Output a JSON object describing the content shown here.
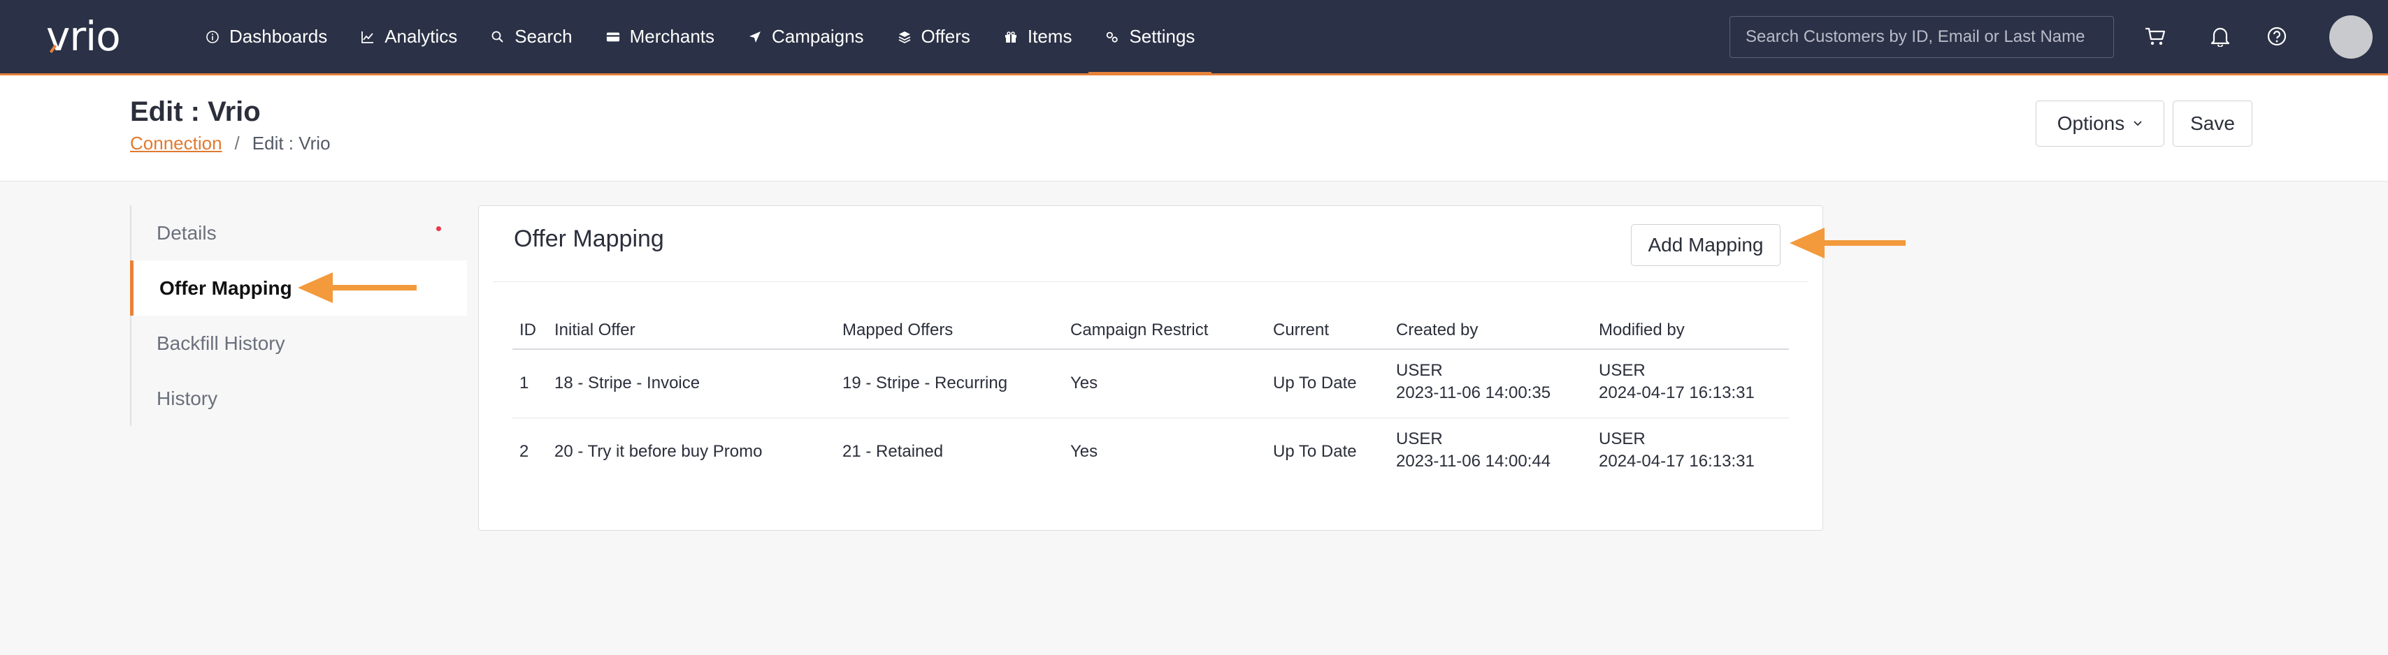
{
  "app": {
    "logo_text": "vrio"
  },
  "nav": {
    "items": [
      {
        "label": "Dashboards",
        "icon": "info-circle-icon"
      },
      {
        "label": "Analytics",
        "icon": "line-chart-icon"
      },
      {
        "label": "Search",
        "icon": "search-icon"
      },
      {
        "label": "Merchants",
        "icon": "credit-card-icon"
      },
      {
        "label": "Campaigns",
        "icon": "paper-plane-icon"
      },
      {
        "label": "Offers",
        "icon": "layers-icon"
      },
      {
        "label": "Items",
        "icon": "gift-box-icon"
      },
      {
        "label": "Settings",
        "icon": "gears-icon"
      }
    ],
    "active": "Settings",
    "search_placeholder": "Search Customers by ID, Email or Last Name",
    "icons": [
      "cart-icon",
      "bell-icon",
      "help-icon"
    ]
  },
  "header": {
    "title": "Edit : Vrio",
    "breadcrumb": {
      "link": "Connection",
      "separator": "/",
      "current": "Edit : Vrio"
    },
    "options_label": "Options",
    "save_label": "Save"
  },
  "sidebar": {
    "items": [
      {
        "label": "Details"
      },
      {
        "label": "Offer Mapping"
      },
      {
        "label": "Backfill History"
      },
      {
        "label": "History"
      }
    ],
    "active": "Offer Mapping"
  },
  "card": {
    "title": "Offer Mapping",
    "add_label": "Add Mapping",
    "columns": [
      "ID",
      "Initial Offer",
      "Mapped Offers",
      "Campaign Restrict",
      "Current",
      "Created by",
      "Modified by"
    ],
    "rows": [
      {
        "id": "1",
        "initial": "18 - Stripe - Invoice",
        "mapped": "19 - Stripe - Recurring",
        "restrict": "Yes",
        "current": "Up To Date",
        "created_user": "USER",
        "created_at": "2023-11-06 14:00:35",
        "modified_user": "USER",
        "modified_at": "2024-04-17 16:13:31"
      },
      {
        "id": "2",
        "initial": "20 - Try it before buy Promo",
        "mapped": "21 - Retained",
        "restrict": "Yes",
        "current": "Up To Date",
        "created_user": "USER",
        "created_at": "2023-11-06 14:00:44",
        "modified_user": "USER",
        "modified_at": "2024-04-17 16:13:31"
      }
    ]
  },
  "colors": {
    "nav_bg": "#2b3146",
    "accent": "#e8823a",
    "arrow": "#f29a3c",
    "link": "#e07a30"
  }
}
